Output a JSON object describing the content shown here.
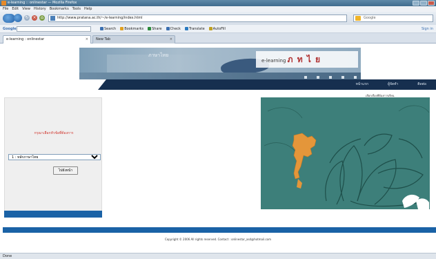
{
  "window": {
    "title": "e-learning :: onlinestar — Mozilla Firefox"
  },
  "menu": [
    "File",
    "Edit",
    "View",
    "History",
    "Bookmarks",
    "Tools",
    "Help"
  ],
  "nav": {
    "url": "http://www.pratana.ac.th/~/e-learning/index.html",
    "search_placeholder": "Google"
  },
  "toolbar": {
    "brand": "Google",
    "items": [
      {
        "label": "Search",
        "color": "#3a6fb0"
      },
      {
        "label": "Bookmarks",
        "color": "#e0a020"
      },
      {
        "label": "Share",
        "color": "#2a8a3a"
      },
      {
        "label": "Check",
        "color": "#3a6fb0"
      },
      {
        "label": "Translate",
        "color": "#2a7ac0"
      },
      {
        "label": "AutoFill",
        "color": "#c0a020"
      }
    ],
    "signin": "Sign in"
  },
  "tabs": [
    {
      "label": "e-learning : onlinestar",
      "active": true
    },
    {
      "label": "New Tab",
      "active": false
    }
  ],
  "banner": {
    "sub_logo": "ภาษาไทย",
    "logo_text": "e-learning",
    "logo_thai": "ภ ท ไ ย"
  },
  "nav_links": [
    "หน้าแรก",
    "ผู้จัดทำ",
    "ติดต่อ"
  ],
  "map_caption": "เลือกเรื่องที่ต้องการเรียน",
  "sidebar": {
    "headline": "กรุณาเลือกหัวข้อที่ต้องการ",
    "select_value": "1 : หลักภาษาไทย",
    "go_label": "ไปยังหน้า"
  },
  "footer": {
    "text": "Copyright © 2006 All rights reserved. Contact : onlinestar_asd@hotmail.com"
  },
  "status": {
    "text": "Done"
  }
}
